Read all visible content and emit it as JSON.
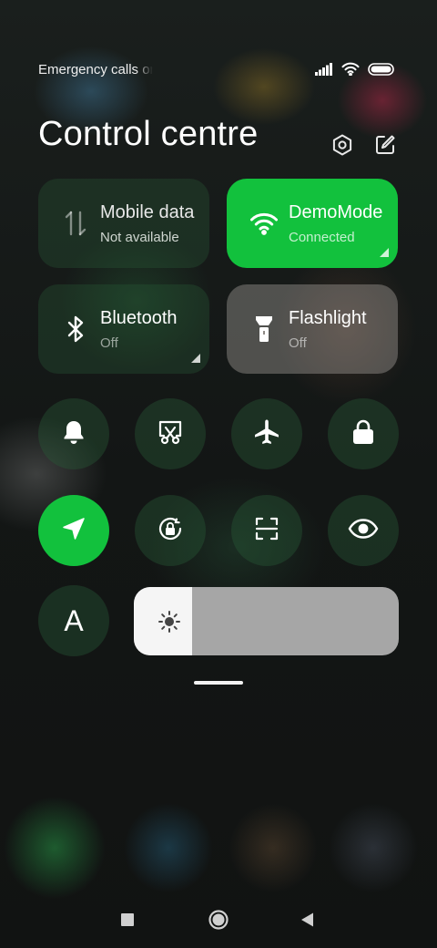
{
  "status_bar": {
    "text": "Emergency calls only",
    "icons": [
      "signal-icon",
      "wifi-icon",
      "battery-icon"
    ]
  },
  "header": {
    "title": "Control centre",
    "icons": [
      "settings-icon",
      "edit-icon"
    ]
  },
  "tiles": {
    "mobile_data": {
      "label": "Mobile data",
      "status": "Not available",
      "icon": "mobile-data-icon"
    },
    "wifi": {
      "label": "DemoMode",
      "status": "Connected",
      "icon": "wifi-icon",
      "active": true
    },
    "bluetooth": {
      "label": "Bluetooth",
      "status": "Off",
      "icon": "bluetooth-icon"
    },
    "flashlight": {
      "label": "Flashlight",
      "status": "Off",
      "icon": "flashlight-icon"
    }
  },
  "toggles_row1": [
    "bell-icon",
    "screenshot-icon",
    "airplane-icon",
    "lock-icon"
  ],
  "toggles_row2": [
    "location-icon",
    "rotation-lock-icon",
    "scan-icon",
    "eye-icon"
  ],
  "font_button": {
    "label": "A"
  },
  "brightness": {
    "level": 0.22,
    "icon": "sun-icon"
  },
  "nav_bar": [
    "recents-icon",
    "home-icon",
    "back-icon"
  ],
  "colors": {
    "accent": "#12c13d",
    "tile_dark": "#2a4a34"
  }
}
